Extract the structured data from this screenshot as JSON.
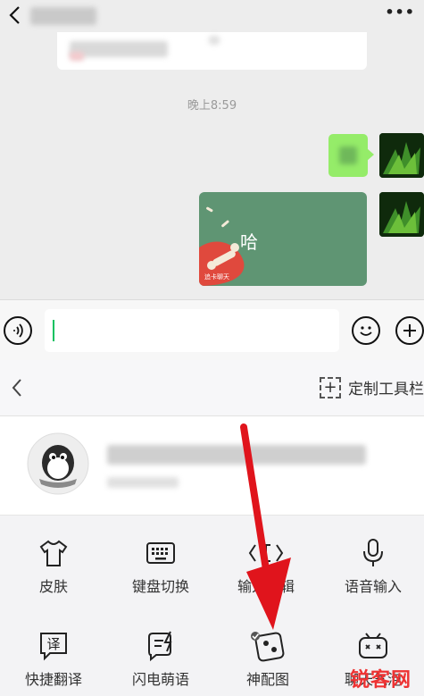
{
  "chat": {
    "timestamp": "晚上8:59",
    "sticker_text": "哈",
    "sticker_caption": "追卡聊天",
    "more_label": "•••"
  },
  "panel": {
    "customize_label": "定制工具栏",
    "tools": [
      {
        "label": "皮肤",
        "icon": "tshirt-icon"
      },
      {
        "label": "键盘切换",
        "icon": "keyboard-icon"
      },
      {
        "label": "输入编辑",
        "icon": "edit-cursor-icon"
      },
      {
        "label": "语音输入",
        "icon": "microphone-icon"
      },
      {
        "label": "快捷翻译",
        "icon": "translate-icon"
      },
      {
        "label": "闪电萌语",
        "icon": "flash-chat-icon"
      },
      {
        "label": "神配图",
        "icon": "picture-dice-icon"
      },
      {
        "label": "聊天气泡",
        "icon": "robot-bubble-icon"
      }
    ]
  },
  "watermark": "锐客网",
  "colors": {
    "accent": "#07c160",
    "bubble": "#95ec69",
    "arrow": "#e0141c"
  }
}
